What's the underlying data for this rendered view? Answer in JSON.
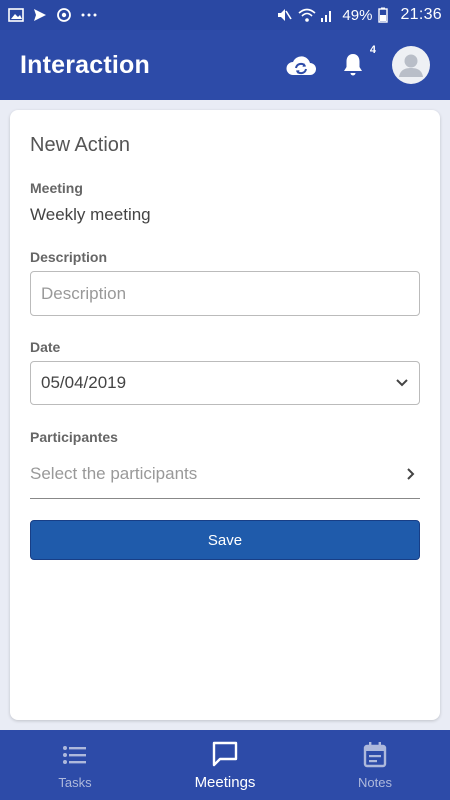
{
  "status_bar": {
    "battery_pct": "49%",
    "time": "21:36",
    "left_icons": [
      "image-icon",
      "send-icon",
      "sync-circle-icon",
      "more-dots-icon"
    ],
    "right_icons": [
      "mute-icon",
      "wifi-icon",
      "signal-icon",
      "battery-icon"
    ]
  },
  "app_bar": {
    "title": "Interaction",
    "notification_count": "4",
    "icons": [
      "cloud-sync-icon",
      "bell-icon",
      "avatar-icon"
    ]
  },
  "form": {
    "title": "New Action",
    "meeting_label": "Meeting",
    "meeting_value": "Weekly meeting",
    "description_label": "Description",
    "description_placeholder": "Description",
    "description_value": "",
    "date_label": "Date",
    "date_value": "05/04/2019",
    "participants_label": "Participantes",
    "participants_placeholder": "Select the participants",
    "save_label": "Save"
  },
  "bottom_nav": {
    "items": [
      {
        "label": "Tasks",
        "icon": "list-icon",
        "active": false
      },
      {
        "label": "Meetings",
        "icon": "chat-icon",
        "active": true
      },
      {
        "label": "Notes",
        "icon": "calendar-icon",
        "active": false
      }
    ]
  },
  "colors": {
    "primary": "#2d4ba8",
    "button": "#1f5bab",
    "background": "#e9ecf5"
  }
}
